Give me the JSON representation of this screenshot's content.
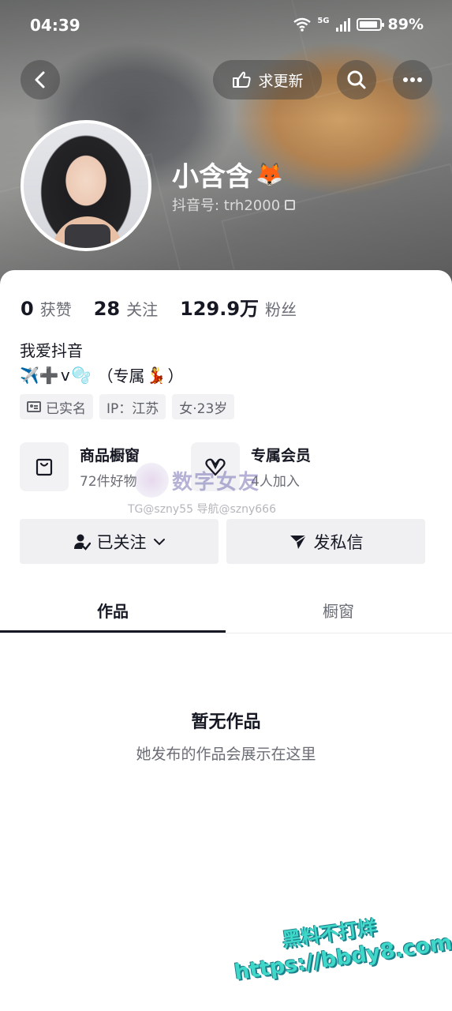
{
  "status_bar": {
    "time": "04:39",
    "network": "5G",
    "battery": "89%"
  },
  "header": {
    "request_update_label": "求更新"
  },
  "profile": {
    "name": "小含含",
    "name_emoji": "🦊",
    "douyin_id": "抖音号: trh2000"
  },
  "stats": [
    {
      "value": "0",
      "label": "获赞"
    },
    {
      "value": "28",
      "label": "关注"
    },
    {
      "value": "129.9万",
      "label": "粉丝"
    }
  ],
  "bio": {
    "line1": "我爱抖音",
    "line2_emojis": "✈️➕",
    "line2_v": "v",
    "line2_bubble": "🫧",
    "line2_text": "（专属",
    "line2_dancer": "💃",
    "line2_close": "）"
  },
  "tags": {
    "verified": "已实名",
    "ip": "IP：江苏",
    "gender_age": "女·23岁"
  },
  "features": {
    "shop_title": "商品橱窗",
    "shop_sub": "72件好物",
    "member_title": "专属会员",
    "member_sub": "4人加入"
  },
  "watermark": {
    "brand": "数字女友",
    "contact": "TG@szny55  导航@szny666",
    "bottom_line1": "黑料不打烊",
    "bottom_line2": "https://bbdy8.com"
  },
  "actions": {
    "following": "已关注",
    "message": "发私信"
  },
  "tabs": [
    "作品",
    "橱窗"
  ],
  "empty": {
    "title": "暂无作品",
    "subtitle": "她发布的作品会展示在这里"
  },
  "colors": {
    "text_primary": "#161823",
    "text_secondary": "#6b6d75",
    "button_bg": "#f0f0f2"
  }
}
